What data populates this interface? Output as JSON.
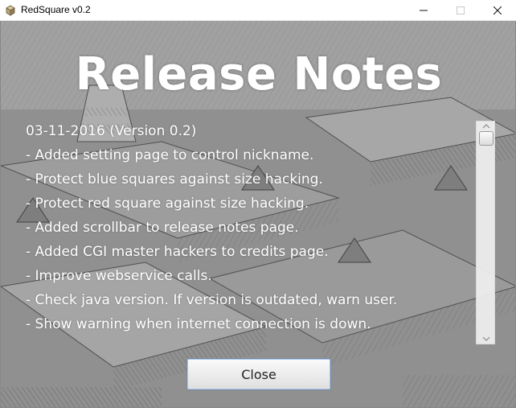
{
  "window": {
    "title": "RedSquare v0.2",
    "controls": {
      "minimize": "minimize-icon",
      "maximize": "maximize-icon",
      "close": "close-icon"
    }
  },
  "release_notes": {
    "heading": "Release Notes",
    "lines": [
      "03-11-2016 (Version 0.2)",
      "- Added setting page to control nickname.",
      "- Protect blue squares against size hacking.",
      "- Protect red square against size hacking.",
      "- Added scrollbar to release notes page.",
      "- Added CGI master hackers to credits page.",
      "- Improve webservice calls.",
      "- Check java version. If version is outdated, warn user.",
      "- Show warning when internet connection is down."
    ],
    "close_label": "Close"
  },
  "colors": {
    "text": "#ffffff",
    "button_border": "#7a8aa0",
    "button_focus": "#a9c7ec"
  }
}
